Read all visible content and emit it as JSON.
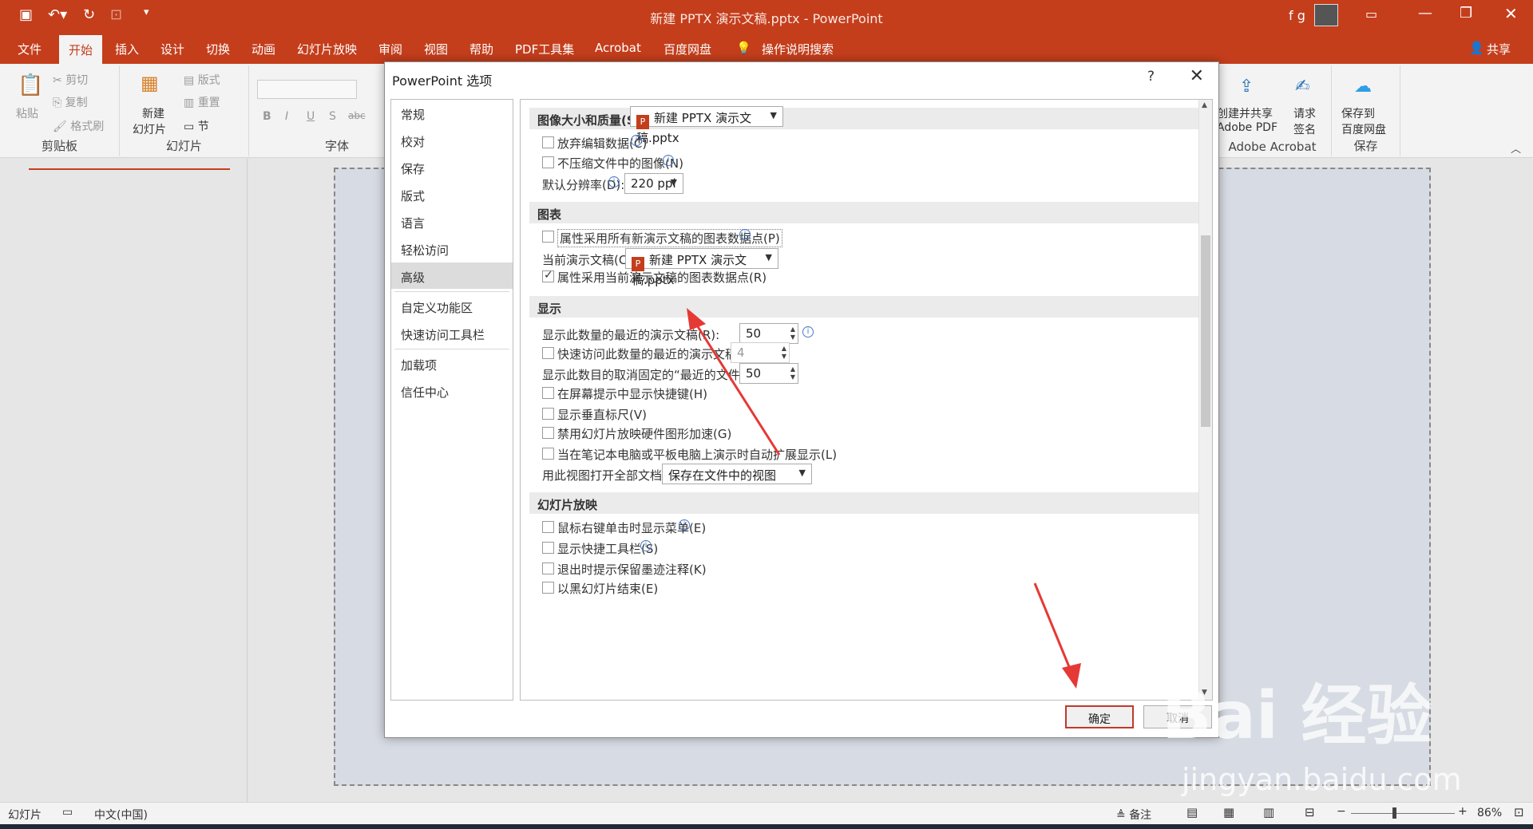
{
  "app": {
    "title": "新建 PPTX 演示文稿.pptx  -  PowerPoint",
    "user": "f g",
    "share": "共享",
    "colors": {
      "accent": "#c43e1c",
      "dialog_bg": "#ffffff",
      "arrow": "#e53935"
    }
  },
  "menu": {
    "tabs": [
      "文件",
      "开始",
      "插入",
      "设计",
      "切换",
      "动画",
      "幻灯片放映",
      "审阅",
      "视图",
      "帮助",
      "PDF工具集",
      "Acrobat",
      "百度网盘"
    ],
    "active": "开始",
    "search": "操作说明搜索"
  },
  "ribbon": {
    "clipboard": {
      "paste": "粘贴",
      "cut": "剪切",
      "copy": "复制",
      "format_painter": "格式刷",
      "label": "剪贴板"
    },
    "slides": {
      "new_slide": "新建",
      "new_slide2": "幻灯片",
      "layout": "版式",
      "reset": "重置",
      "section": "节",
      "label": "幻灯片"
    },
    "font": {
      "label": "字体",
      "bold": "B",
      "italic": "I",
      "underline": "U",
      "shadow": "S",
      "strike": "abc"
    },
    "acrobat": {
      "create": "创建并共享",
      "create2": "Adobe PDF",
      "request": "请求",
      "request2": "签名",
      "label": "Adobe Acrobat"
    },
    "save": {
      "save_to": "保存到",
      "save_to2": "百度网盘",
      "label": "保存"
    }
  },
  "dialog": {
    "title": "PowerPoint 选项",
    "help": "?",
    "close": "✕",
    "nav": [
      "常规",
      "校对",
      "保存",
      "版式",
      "语言",
      "轻松访问",
      "高级",
      "自定义功能区",
      "快速访问工具栏",
      "加载项",
      "信任中心"
    ],
    "nav_selected": "高级",
    "sections": {
      "image": {
        "header": "图像大小和质量(S)",
        "file": "新建 PPTX 演示文稿.pptx",
        "discard": "放弃编辑数据(C)",
        "no_compress": "不压缩文件中的图像(N)",
        "resolution_label": "默认分辨率(D):",
        "resolution": "220 ppi"
      },
      "chart": {
        "header": "图表",
        "all_new": "属性采用所有新演示文稿的图表数据点(P)",
        "current_label": "当前演示文稿(C):",
        "current_file": "新建 PPTX 演示文稿.pptx",
        "current_prop": "属性采用当前演示文稿的图表数据点(R)"
      },
      "display": {
        "header": "显示",
        "recent_label": "显示此数量的最近的演示文稿(R):",
        "recent_value": "50",
        "quick_label": "快速访问此数量的最近的演示文稿(Q):",
        "quick_value": "4",
        "unpinned_label": "显示此数目的取消固定的“最近的文件夹”(F):",
        "unpinned_value": "50",
        "shortcut": "在屏幕提示中显示快捷键(H)",
        "vruler": "显示垂直标尺(V)",
        "hw_accel": "禁用幻灯片放映硬件图形加速(G)",
        "auto_extend": "当在笔记本电脑或平板电脑上演示时自动扩展显示(L)",
        "open_view_label": "用此视图打开全部文档(O)",
        "open_view": "保存在文件中的视图"
      },
      "slideshow": {
        "header": "幻灯片放映",
        "right_click": "鼠标右键单击时显示菜单(E)",
        "toolbar": "显示快捷工具栏(S)",
        "ink": "退出时提示保留墨迹注释(K)",
        "black": "以黑幻灯片结束(E)"
      }
    },
    "ok": "确定",
    "cancel": "取消"
  },
  "status": {
    "slide": "幻灯片",
    "lang": "中文(中国)",
    "notes": "备注",
    "zoom": "86%"
  },
  "watermark": {
    "brand": "Bai 经验",
    "url": "jingyan.baidu.com"
  }
}
